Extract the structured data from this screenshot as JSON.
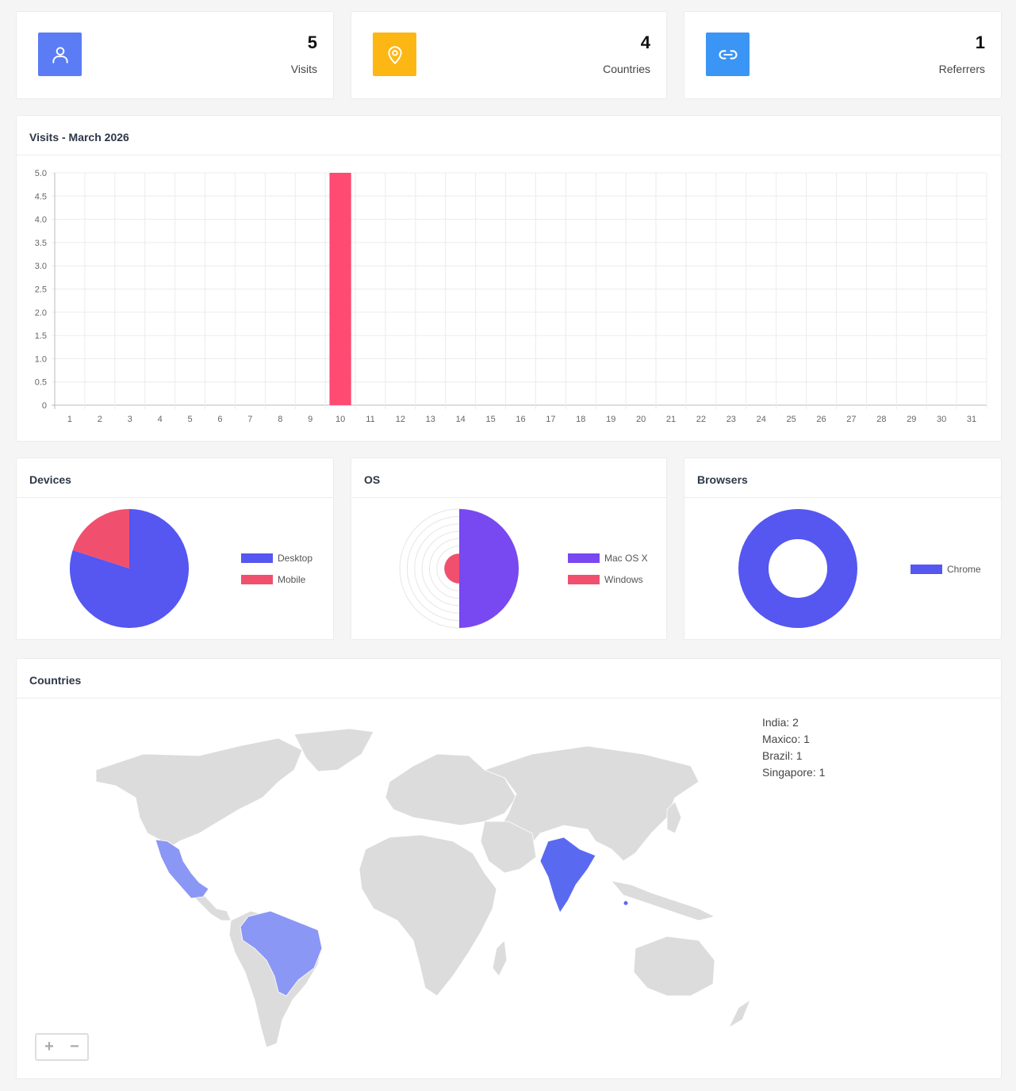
{
  "stats": [
    {
      "value": "5",
      "label": "Visits",
      "icon": "user-icon",
      "color": "#5b7cf5"
    },
    {
      "value": "4",
      "label": "Countries",
      "icon": "map-pin-icon",
      "color": "#fdb714"
    },
    {
      "value": "1",
      "label": "Referrers",
      "icon": "link-icon",
      "color": "#3b95f5"
    }
  ],
  "visits_chart": {
    "title": "Visits - March 2026",
    "chart_data": {
      "type": "bar",
      "categories": [
        "1",
        "2",
        "3",
        "4",
        "5",
        "6",
        "7",
        "8",
        "9",
        "10",
        "11",
        "12",
        "13",
        "14",
        "15",
        "16",
        "17",
        "18",
        "19",
        "20",
        "21",
        "22",
        "23",
        "24",
        "25",
        "26",
        "27",
        "28",
        "29",
        "30",
        "31"
      ],
      "values": [
        0,
        0,
        0,
        0,
        0,
        0,
        0,
        0,
        0,
        5,
        0,
        0,
        0,
        0,
        0,
        0,
        0,
        0,
        0,
        0,
        0,
        0,
        0,
        0,
        0,
        0,
        0,
        0,
        0,
        0,
        0
      ],
      "y_ticks": [
        "0",
        "0.5",
        "1.0",
        "1.5",
        "2.0",
        "2.5",
        "3.0",
        "3.5",
        "4.0",
        "4.5",
        "5.0"
      ],
      "ylim": [
        0,
        5
      ],
      "grid": true,
      "bar_color": "#ff4a72"
    }
  },
  "devices": {
    "title": "Devices",
    "chart_data": {
      "type": "pie",
      "series": [
        {
          "name": "Desktop",
          "value": 4,
          "color": "#5656f0"
        },
        {
          "name": "Mobile",
          "value": 1,
          "color": "#f0506e"
        }
      ]
    }
  },
  "os": {
    "title": "OS",
    "chart_data": {
      "type": "polarArea",
      "series": [
        {
          "name": "Mac OS X",
          "value": 4,
          "color": "#7848f0"
        },
        {
          "name": "Windows",
          "value": 1,
          "color": "#f0506e"
        }
      ],
      "rmax": 4
    }
  },
  "browsers": {
    "title": "Browsers",
    "chart_data": {
      "type": "doughnut",
      "series": [
        {
          "name": "Chrome",
          "value": 5,
          "color": "#5656f0"
        }
      ]
    }
  },
  "countries": {
    "title": "Countries",
    "list": [
      "India: 2",
      "Maxico: 1",
      "Brazil: 1",
      "Singapore: 1"
    ],
    "zoom_in": "+",
    "zoom_out": "−",
    "highlight_color": "#5a6af0",
    "highlight_light": "#8b97f5",
    "land_color": "#dcdcdc"
  }
}
